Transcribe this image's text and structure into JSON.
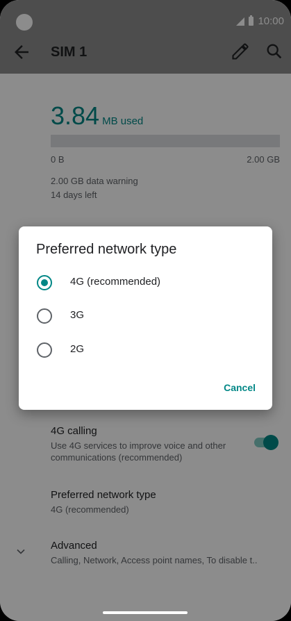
{
  "status_bar": {
    "time": "10:00"
  },
  "app_bar": {
    "title": "SIM 1"
  },
  "usage": {
    "value": "3.84",
    "unit": "MB used",
    "scale_min": "0 B",
    "scale_max": "2.00 GB",
    "warning": "2.00 GB data warning",
    "days_left": "14 days left"
  },
  "settings": {
    "calling_title": "4G calling",
    "calling_sub": "Use 4G services to improve voice and other communications (recommended)",
    "network_title": "Preferred network type",
    "network_sub": "4G (recommended)",
    "advanced_title": "Advanced",
    "advanced_sub": "Calling, Network, Access point names, To disable t.."
  },
  "dialog": {
    "title": "Preferred network type",
    "options": [
      {
        "label": "4G (recommended)",
        "selected": true
      },
      {
        "label": "3G",
        "selected": false
      },
      {
        "label": "2G",
        "selected": false
      }
    ],
    "cancel_label": "Cancel"
  },
  "colors": {
    "accent": "#018786"
  }
}
